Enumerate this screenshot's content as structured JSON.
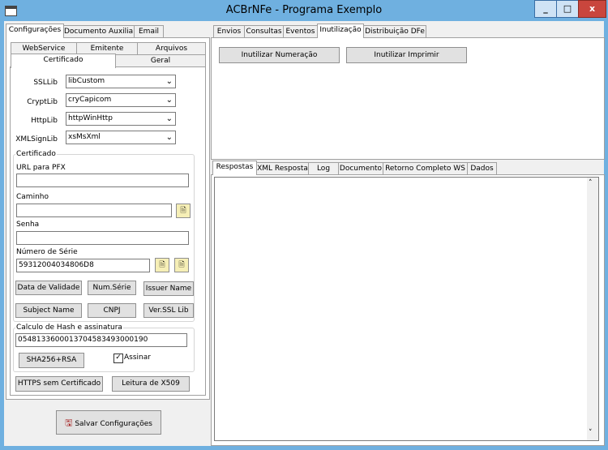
{
  "window": {
    "title": "ACBrNFe - Programa Exemplo",
    "minimize": "_",
    "maximize": "□",
    "close": "x"
  },
  "left_tabs": [
    "Configurações",
    "Documento Auxiliar",
    "Email"
  ],
  "config_tabs_row1": [
    "WebService",
    "Emitente",
    "Arquivos"
  ],
  "config_tabs_row2": [
    "Certificado",
    "Geral"
  ],
  "libs": {
    "ssl": {
      "label": "SSLLib",
      "value": "libCustom"
    },
    "crypt": {
      "label": "CryptLib",
      "value": "cryCapicom"
    },
    "http": {
      "label": "HttpLib",
      "value": "httpWinHttp"
    },
    "xmlsign": {
      "label": "XMLSignLib",
      "value": "xsMsXml"
    }
  },
  "certificado": {
    "title": "Certificado",
    "url_label": "URL para PFX",
    "url_value": "",
    "caminho_label": "Caminho",
    "caminho_value": "",
    "senha_label": "Senha",
    "senha_value": "",
    "serie_label": "Número de Série",
    "serie_value": "59312004034806D8",
    "buttons": [
      "Data de Validade",
      "Num.Série",
      "Issuer Name",
      "Subject Name",
      "CNPJ",
      "Ver.SSL Lib"
    ]
  },
  "hash": {
    "title": "Calculo de Hash e assinatura",
    "value": "05481336000137045834930001​90",
    "sha_button": "SHA256+RSA",
    "assinar_label": "Assinar",
    "assinar_checked": "✓"
  },
  "bottom_buttons": {
    "https": "HTTPS sem Certificado",
    "x509": "Leitura de X509"
  },
  "save_button": "Salvar Configurações",
  "right_tabs": [
    "Envios",
    "Consultas",
    "Eventos",
    "Inutilização",
    "Distribuição DFe"
  ],
  "right_buttons": {
    "inutilizar": "Inutilizar Numeração",
    "imprimir": "Inutilizar Imprimir"
  },
  "bottom_tabs": [
    "Respostas",
    "XML Resposta",
    "Log",
    "Documento",
    "Retorno Completo WS",
    "Dados"
  ]
}
